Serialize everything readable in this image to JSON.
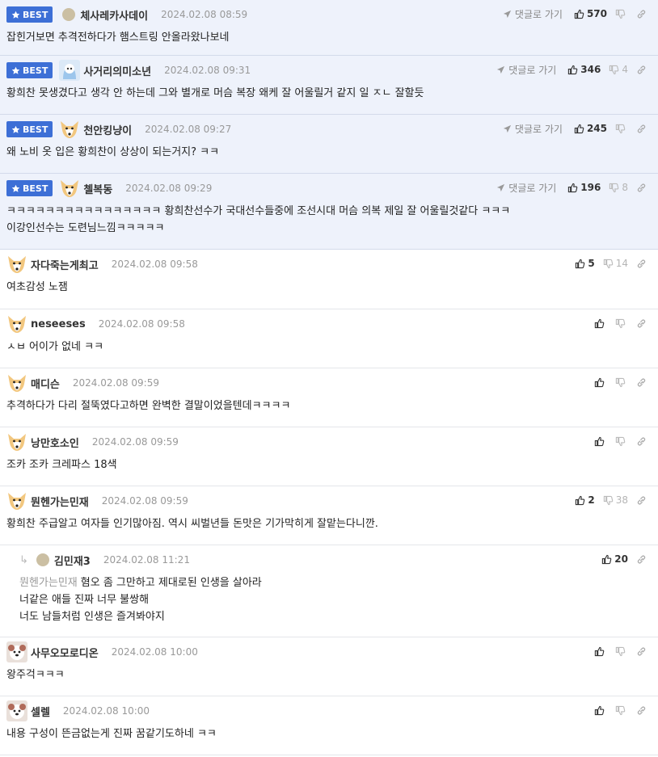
{
  "labels": {
    "best": "BEST",
    "goto_reply": "댓글로 가기"
  },
  "comments": [
    {
      "best": true,
      "avatar": "dot",
      "nick": "체사레카사데이",
      "date": "2024.02.08 08:59",
      "up": "570",
      "down": "",
      "goto": true,
      "lines": [
        "잡힌거보면 추격전하다가 햄스트링 안올라왔나보네"
      ]
    },
    {
      "best": true,
      "avatar": "penguin",
      "nick": "사거리의미소년",
      "date": "2024.02.08 09:31",
      "up": "346",
      "down": "4",
      "goto": true,
      "lines": [
        "황희찬 못생겼다고 생각 안 하는데 그와 별개로 머슴 복장 왜케 잘 어울릴거 같지 일 ㅈㄴ 잘할듯"
      ]
    },
    {
      "best": true,
      "avatar": "fox",
      "nick": "천안킹냥이",
      "date": "2024.02.08 09:27",
      "up": "245",
      "down": "",
      "goto": true,
      "lines": [
        "왜 노비 옷 입은 황희찬이 상상이 되는거지? ㅋㅋ"
      ]
    },
    {
      "best": true,
      "avatar": "fox",
      "nick": "첼복동",
      "date": "2024.02.08 09:29",
      "up": "196",
      "down": "8",
      "goto": true,
      "lines": [
        "ㅋㅋㅋㅋㅋㅋㅋㅋㅋㅋㅋㅋㅋㅋㅋㅋ 황희찬선수가 국대선수들중에 조선시대 머슴 의복 제일 잘 어울릴것같다 ㅋㅋㅋ",
        "이강인선수는 도련님느낌ㅋㅋㅋㅋㅋ"
      ]
    },
    {
      "best": false,
      "avatar": "fox",
      "nick": "자다죽는게최고",
      "date": "2024.02.08 09:58",
      "up": "5",
      "down": "14",
      "lines": [
        "여초감성 노잼"
      ]
    },
    {
      "best": false,
      "avatar": "fox",
      "nick": "neseeses",
      "date": "2024.02.08 09:58",
      "up": "",
      "down": "",
      "lines": [
        "ㅅㅂ 어이가 없네 ㅋㅋ"
      ]
    },
    {
      "best": false,
      "avatar": "fox",
      "nick": "매디슨",
      "date": "2024.02.08 09:59",
      "up": "",
      "down": "",
      "lines": [
        "추격하다가 다리 절뚝였다고하면 완벽한 결말이었을텐데ㅋㅋㅋㅋ"
      ]
    },
    {
      "best": false,
      "avatar": "fox",
      "nick": "낭만호소인",
      "date": "2024.02.08 09:59",
      "up": "",
      "down": "",
      "lines": [
        "조카 조카 크레파스 18색"
      ]
    },
    {
      "best": false,
      "avatar": "fox",
      "nick": "뭔헨가는민재",
      "date": "2024.02.08 09:59",
      "up": "2",
      "down": "38",
      "lines": [
        "황희찬 주급알고 여자들 인기많아짐. 역시 씨벌년들 돈맛은 기가막히게 잘맡는다니깐."
      ]
    },
    {
      "best": false,
      "reply": true,
      "avatar": "dot",
      "nick": "김민재3",
      "date": "2024.02.08 11:21",
      "up": "20",
      "down": "",
      "no_down": true,
      "mention": "뭔헨가는민재",
      "lines": [
        "혐오 좀 그만하고 제대로된 인생을 살아라",
        "너같은 애들 진짜 너무 불쌍해",
        "너도 남들처럼 인생은 즐겨봐야지"
      ]
    },
    {
      "best": false,
      "avatar": "dog",
      "nick": "사무오모로디온",
      "date": "2024.02.08 10:00",
      "up": "",
      "down": "",
      "lines": [
        "왕주걱ㅋㅋㅋ"
      ]
    },
    {
      "best": false,
      "avatar": "dog",
      "nick": "셀렐",
      "date": "2024.02.08 10:00",
      "up": "",
      "down": "",
      "lines": [
        "내용 구성이 뜬금없는게 진짜 꿈같기도하네 ㅋㅋ"
      ]
    }
  ]
}
